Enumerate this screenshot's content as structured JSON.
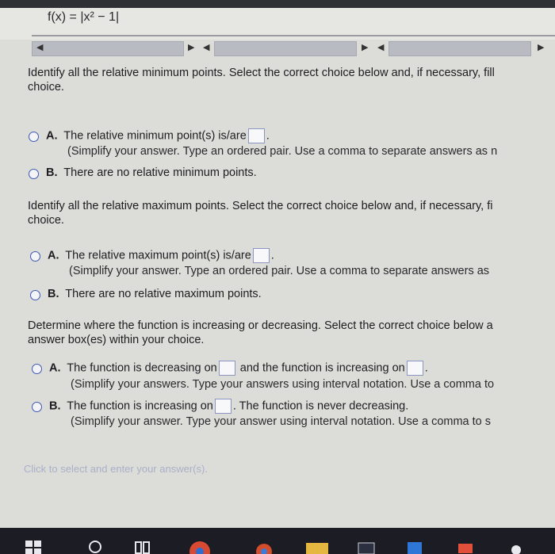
{
  "header": {
    "function_expression": "f(x) = |x² − 1|"
  },
  "q1": {
    "prompt": "Identify all the relative minimum points. Select the correct choice below and, if necessary, fill",
    "prompt_line2": "choice.",
    "optA_letter": "A.",
    "optA_text": "The relative minimum point(s) is/are",
    "optA_end": ".",
    "optA_hint": "(Simplify your answer. Type an ordered pair. Use a comma to separate answers as n",
    "optB_letter": "B.",
    "optB_text": "There are no relative minimum points."
  },
  "q2": {
    "prompt": "Identify all the relative maximum points. Select the correct choice below and, if necessary, fi",
    "prompt_line2": "choice.",
    "optA_letter": "A.",
    "optA_text": "The relative maximum point(s) is/are",
    "optA_end": ".",
    "optA_hint": "(Simplify your answer. Type an ordered pair. Use a comma to separate answers as",
    "optB_letter": "B.",
    "optB_text": "There are no relative maximum points."
  },
  "q3": {
    "prompt": "Determine where the function is increasing or decreasing. Select the correct choice below a",
    "prompt_line2": "answer box(es) within your choice.",
    "optA_letter": "A.",
    "optA_text1": "The function is decreasing on",
    "optA_text2": "and the function is increasing on",
    "optA_end": ".",
    "optA_hint": "(Simplify your answers. Type your answers using interval notation. Use a comma to",
    "optB_letter": "B.",
    "optB_text1": "The function is increasing on",
    "optB_text2": ". The function is never decreasing.",
    "optB_hint": "(Simplify your answer. Type your answer using interval notation. Use a comma to s"
  },
  "footer": {
    "prompt": "Click to select and enter your answer(s)."
  }
}
